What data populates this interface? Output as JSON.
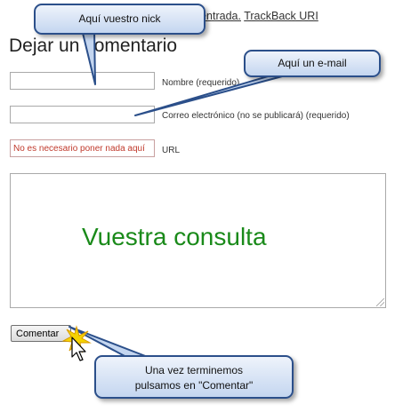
{
  "top_links": {
    "text_fragment": "esta entrada.",
    "trackback_label": "TrackBack URI"
  },
  "form": {
    "title": "Dejar un comentario",
    "name_label": "Nombre (requerido)",
    "name_value": "",
    "email_label": "Correo electrónico (no se publicará) (requerido)",
    "email_value": "",
    "url_label": "URL",
    "url_value": "No es necesario poner nada aquí",
    "comment_text": "Vuestra consulta",
    "submit_label": "Comentar"
  },
  "callouts": {
    "nick": "Aquí vuestro nick",
    "email": "Aquí un e-mail",
    "finish_line1": "Una vez terminemos",
    "finish_line2": "pulsamos en \"Comentar\""
  },
  "colors": {
    "callout_border": "#2b4f8a",
    "callout_fill": "#c4d6f0",
    "comment_text": "#1a8a1a",
    "url_text": "#c0392b"
  }
}
